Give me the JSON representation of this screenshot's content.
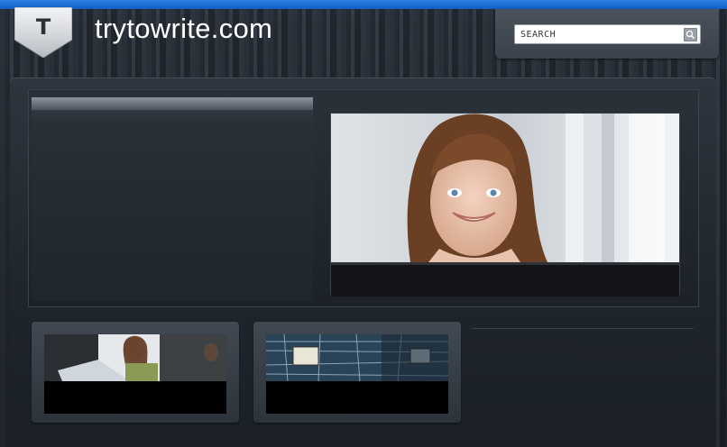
{
  "header": {
    "logo_letter": "T",
    "site_title": "trytowrite.com"
  },
  "search": {
    "placeholder": "SEARCH"
  },
  "featured": {
    "image_alt": "smiling woman portrait"
  },
  "thumbnails": [
    {
      "image_alt": "woman at laptop"
    },
    {
      "image_alt": "circuit board chip"
    }
  ],
  "colors": {
    "top_bar": "#1e6fd8",
    "background": "#1a1f26",
    "title_text": "#ffffff"
  }
}
